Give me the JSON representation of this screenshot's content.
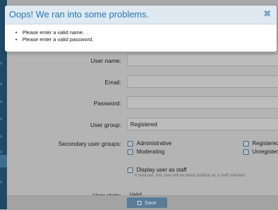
{
  "dialog": {
    "title": "Oops! We ran into some problems.",
    "close_glyph": "✖",
    "errors": [
      "Please enter a valid name.",
      "Please enter a valid password."
    ]
  },
  "form": {
    "username_label": "User name:",
    "email_label": "Email:",
    "password_label": "Password:",
    "user_group_label": "User group:",
    "user_group_value": "Registered",
    "secondary_groups_label": "Secondary user groups:",
    "groups": [
      "Administrative",
      "Registered",
      "Moderating",
      "Unregistered"
    ],
    "display_staff_label": "Display user as staff",
    "display_staff_hint": "If selected, this user will be listed publicly as a staff member.",
    "user_state_label": "User state:",
    "user_state_value": "Valid",
    "save_label": "Save"
  },
  "sidebar": {
    "icon": "chevron-icon"
  },
  "colors": {
    "accent": "#2577b1",
    "header": "#dfe9f2",
    "overlay_dim": "#a9a9a9"
  }
}
